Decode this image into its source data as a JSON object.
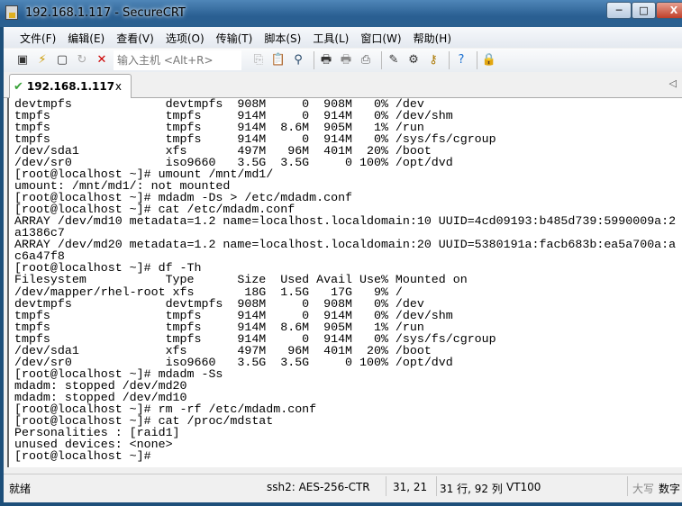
{
  "window": {
    "title": "192.168.1.117 - SecureCRT",
    "minimize": "─",
    "maximize": "□",
    "close": "X"
  },
  "menu": [
    "文件(F)",
    "编辑(E)",
    "查看(V)",
    "选项(O)",
    "传输(T)",
    "脚本(S)",
    "工具(L)",
    "窗口(W)",
    "帮助(H)"
  ],
  "toolbar": {
    "host_placeholder": "输入主机 <Alt+R>"
  },
  "tab": {
    "label": "192.168.1.117",
    "close": "x",
    "scroll": "◁"
  },
  "terminal": {
    "lines": [
      "devtmpfs             devtmpfs  908M     0  908M   0% /dev",
      "tmpfs                tmpfs     914M     0  914M   0% /dev/shm",
      "tmpfs                tmpfs     914M  8.6M  905M   1% /run",
      "tmpfs                tmpfs     914M     0  914M   0% /sys/fs/cgroup",
      "/dev/sda1            xfs       497M   96M  401M  20% /boot",
      "/dev/sr0             iso9660   3.5G  3.5G     0 100% /opt/dvd",
      "[root@localhost ~]# umount /mnt/md1/",
      "umount: /mnt/md1/: not mounted",
      "[root@localhost ~]# mdadm -Ds > /etc/mdadm.conf",
      "[root@localhost ~]# cat /etc/mdadm.conf",
      "ARRAY /dev/md10 metadata=1.2 name=localhost.localdomain:10 UUID=4cd09193:b485d739:5990009a:2",
      "a1386c7",
      "ARRAY /dev/md20 metadata=1.2 name=localhost.localdomain:20 UUID=5380191a:facb683b:ea5a700a:a",
      "c6a47f8",
      "[root@localhost ~]# df -Th",
      "Filesystem           Type      Size  Used Avail Use% Mounted on",
      "/dev/mapper/rhel-root xfs       18G  1.5G   17G   9% /",
      "devtmpfs             devtmpfs  908M     0  908M   0% /dev",
      "tmpfs                tmpfs     914M     0  914M   0% /dev/shm",
      "tmpfs                tmpfs     914M  8.6M  905M   1% /run",
      "tmpfs                tmpfs     914M     0  914M   0% /sys/fs/cgroup",
      "/dev/sda1            xfs       497M   96M  401M  20% /boot",
      "/dev/sr0             iso9660   3.5G  3.5G     0 100% /opt/dvd",
      "[root@localhost ~]# mdadm -Ss",
      "mdadm: stopped /dev/md20",
      "mdadm: stopped /dev/md10",
      "[root@localhost ~]# rm -rf /etc/mdadm.conf",
      "[root@localhost ~]# cat /proc/mdstat",
      "Personalities : [raid1]",
      "unused devices: <none>",
      "[root@localhost ~]#"
    ]
  },
  "status": {
    "ready": "就绪",
    "cipher": "ssh2: AES-256-CTR",
    "cursor": "31,  21",
    "size": "31 行, 92 列",
    "emulation": "VT100",
    "caps": "大写",
    "num": "数字"
  }
}
